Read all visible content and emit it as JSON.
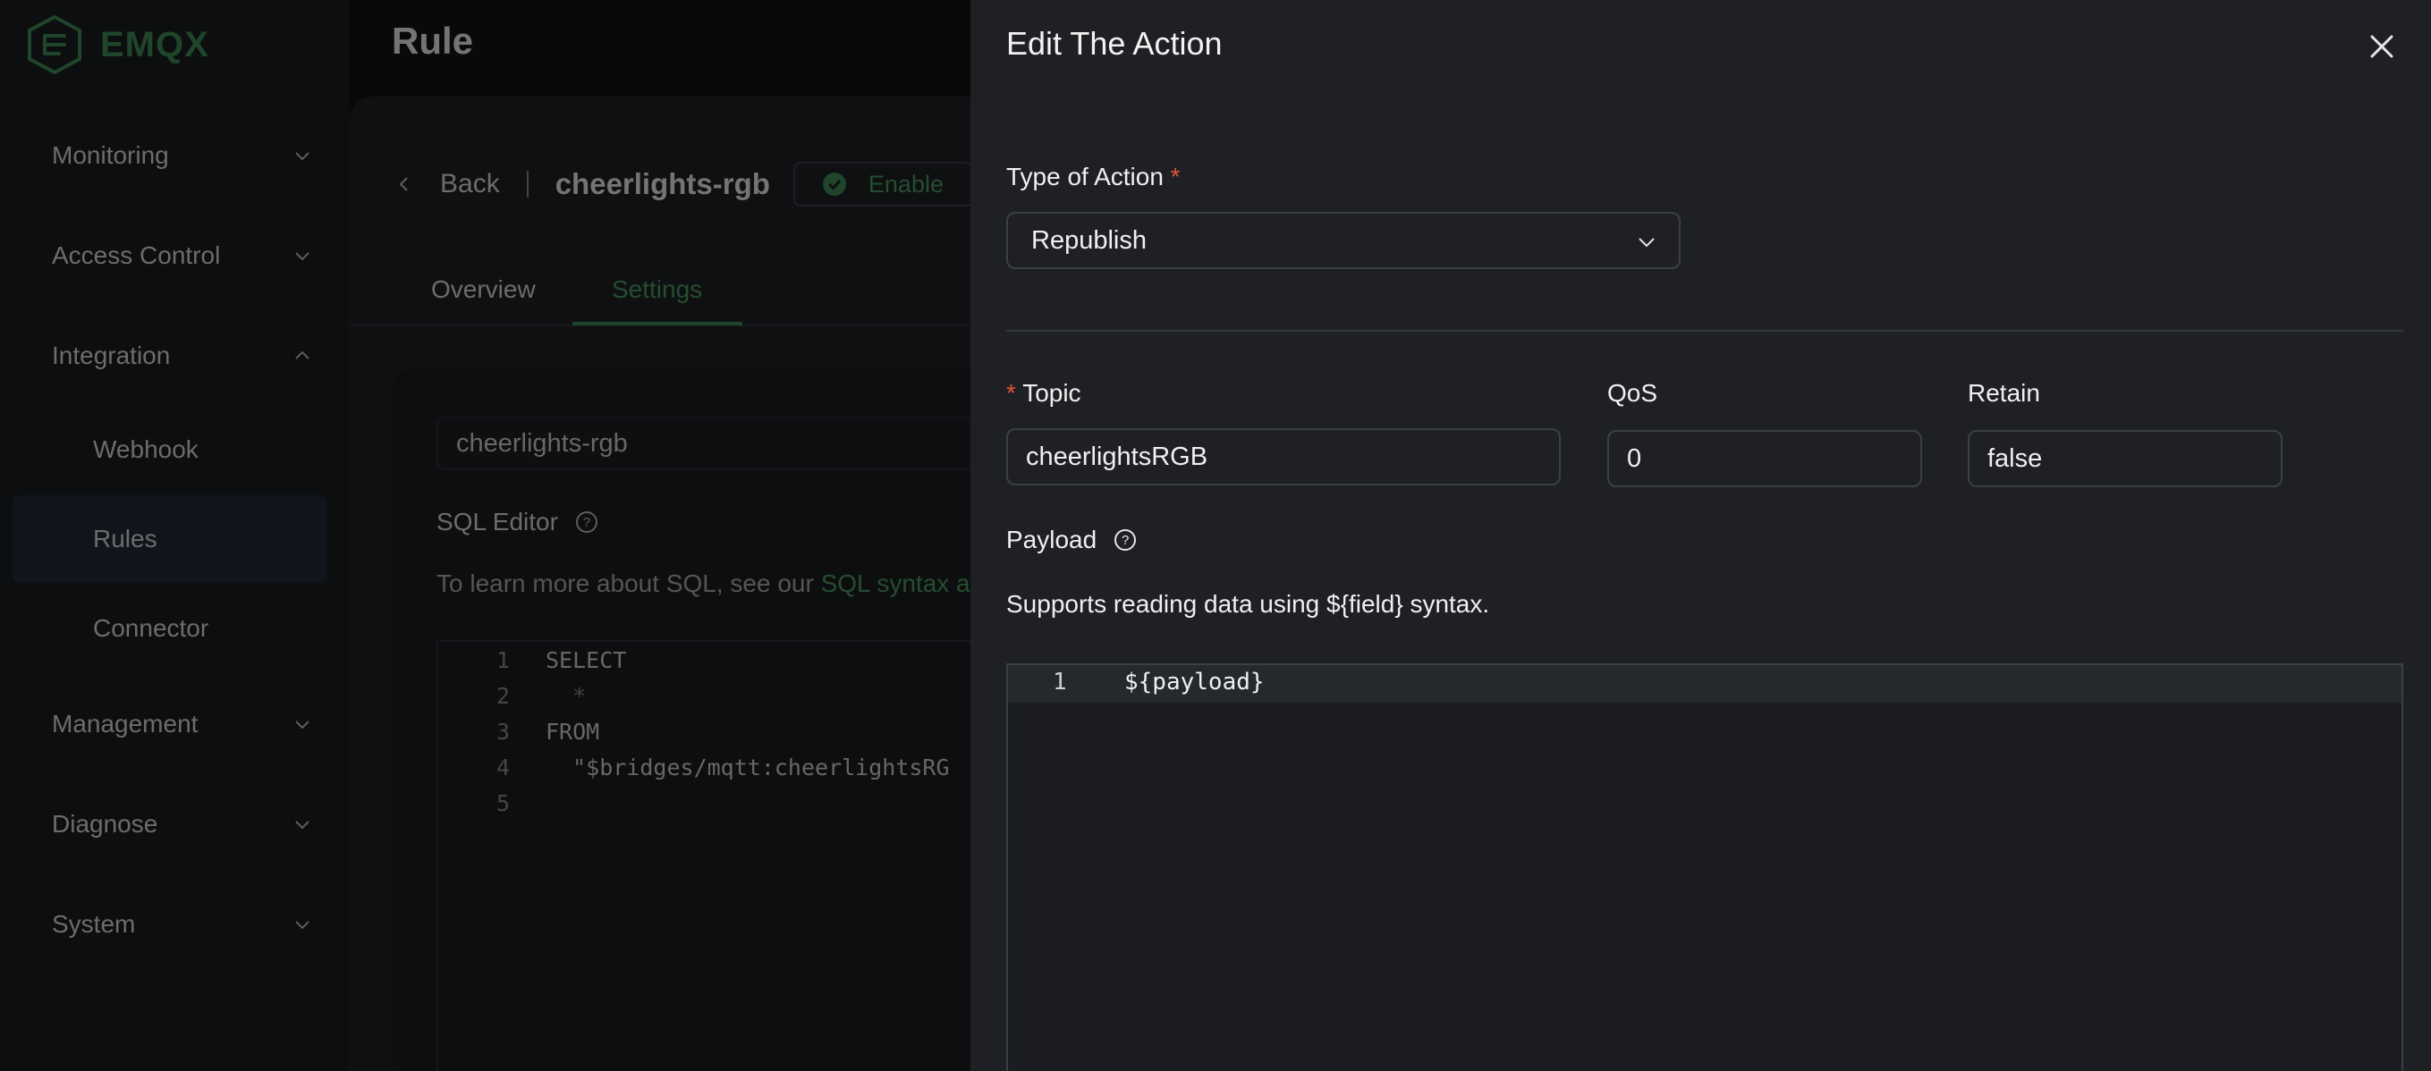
{
  "app": {
    "logo_text": "EMQX",
    "page_title": "Rule"
  },
  "sidebar": {
    "items": [
      {
        "label": "Monitoring"
      },
      {
        "label": "Access Control"
      },
      {
        "label": "Integration"
      },
      {
        "label": "Management"
      },
      {
        "label": "Diagnose"
      },
      {
        "label": "System"
      }
    ],
    "sub_items": [
      {
        "label": "Webhook"
      },
      {
        "label": "Rules"
      },
      {
        "label": "Connector"
      }
    ]
  },
  "rule": {
    "back_label": "Back",
    "name": "cheerlights-rgb",
    "status": "Enable",
    "tabs": [
      {
        "label": "Overview"
      },
      {
        "label": "Settings"
      }
    ],
    "name_value": "cheerlights-rgb",
    "sql_editor_label": "SQL Editor",
    "sql_hint_prefix": "To learn more about SQL, see our ",
    "sql_hint_link": "SQL syntax an",
    "sql_lines": [
      {
        "n": "1",
        "text": "SELECT"
      },
      {
        "n": "2",
        "text": "  *"
      },
      {
        "n": "3",
        "text": "FROM"
      },
      {
        "n": "4",
        "text": "  \"$bridges/mqtt:cheerlightsRG"
      },
      {
        "n": "5",
        "text": ""
      }
    ]
  },
  "drawer": {
    "title": "Edit The Action",
    "type_label": "Type of Action",
    "required_mark": "*",
    "type_value": "Republish",
    "topic_label": "Topic",
    "topic_value": "cheerlightsRGB",
    "qos_label": "QoS",
    "qos_value": "0",
    "retain_label": "Retain",
    "retain_value": "false",
    "payload_label": "Payload",
    "payload_hint": "Supports reading data using ${field} syntax.",
    "payload_line_number": "1",
    "payload_code": "${payload}"
  },
  "colors": {
    "accent": "#3f8a55",
    "required": "#e0553b",
    "drawer_bg": "#1e2024"
  }
}
